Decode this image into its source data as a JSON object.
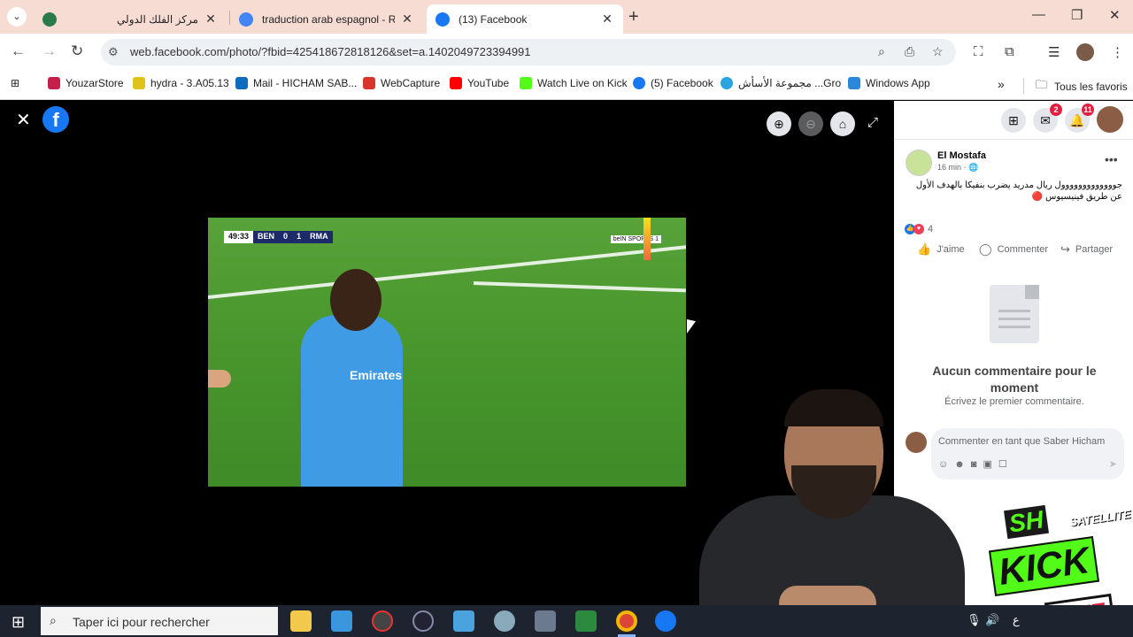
{
  "browser": {
    "tabs": [
      {
        "title": "مركز الفلك الدولي",
        "favicon_color": "#2b7a4b",
        "active": false
      },
      {
        "title": "traduction arab espagnol - Rech",
        "favicon_color": "#4285f4",
        "active": false
      },
      {
        "title": "(13) Facebook",
        "favicon_color": "#1877f2",
        "active": true
      }
    ],
    "new_tab": "+",
    "url": "web.facebook.com/photo/?fbid=425418672818126&set=a.1402049723394991",
    "bookmarks": [
      {
        "label": "YouzarStore",
        "color": "#c5204b"
      },
      {
        "label": "hydra - 3.A05.13",
        "color": "#e0c319"
      },
      {
        "label": "Mail - HICHAM SAB...",
        "color": "#0f6cbd"
      },
      {
        "label": "WebCapture",
        "color": "#d9362b"
      },
      {
        "label": "YouTube",
        "color": "#ff0000"
      },
      {
        "label": "Watch Live on Kick",
        "color": "#53fc18"
      },
      {
        "label": "(5) Facebook",
        "color": "#1877f2"
      },
      {
        "label": "مجموعة الأسأش ...Gro",
        "color": "#2aa3df"
      },
      {
        "label": "Windows App",
        "color": "#2b88d8"
      }
    ],
    "all_bookmarks": "Tous les favoris"
  },
  "viewer": {
    "scoreboard": {
      "clock": "49:33",
      "home": "BEN",
      "home_score": "0",
      "away_score": "1",
      "away": "RMA"
    },
    "broadcaster": "beIN SPORTS 1",
    "jersey_text": "Emirates"
  },
  "post": {
    "author": "El Mostafa",
    "time": "16 min · 🌐",
    "text": "جووووووووووووول ريال مدريد يضرب بنفيكا بالهدف الأول عن طريق فينيسيوس 🔴",
    "reaction_count": "4",
    "actions": {
      "like": "J'aime",
      "comment": "Commenter",
      "share": "Partager"
    },
    "no_comments_title": "Aucun commentaire pour le moment",
    "no_comments_sub": "Écrivez le premier commentaire.",
    "comment_placeholder": "Commenter en tant que Saber Hicham"
  },
  "notifications": {
    "messenger": "2",
    "alerts": "11"
  },
  "overlay": {
    "brand": "SH",
    "sub": "SATELLITE",
    "word": "KICK",
    "live": "LIVE"
  },
  "taskbar": {
    "search_placeholder": "Taper ici pour rechercher",
    "lang": "ع"
  }
}
